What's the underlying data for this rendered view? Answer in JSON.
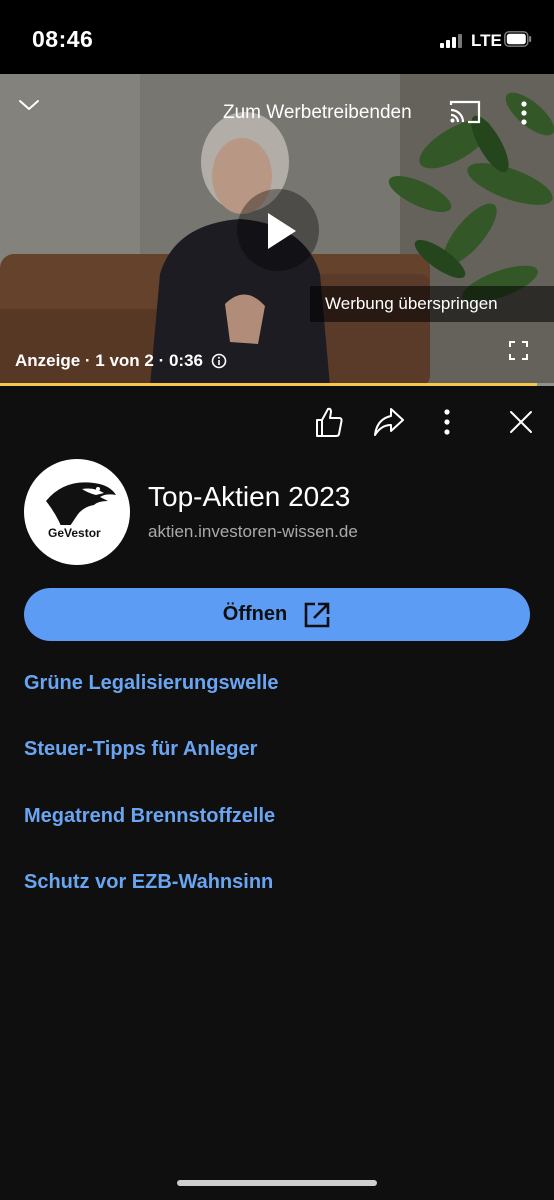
{
  "status_bar": {
    "time": "08:46",
    "network": "LTE"
  },
  "player": {
    "advertiser_link": "Zum Werbetreibenden",
    "skip_label": "Werbung überspringen",
    "ad_info": "Anzeige · 1 von 2 · 0:36",
    "progress_fraction": 0.97,
    "progress_color": "#f5c84c"
  },
  "ad": {
    "logo_text": "GeVestor",
    "title": "Top-Aktien 2023",
    "domain": "aktien.investoren-wissen.de",
    "open_button": "Öffnen",
    "links": [
      "Grüne Legalisierungswelle",
      "Steuer-Tipps für Anleger",
      "Megatrend Brennstoffzelle",
      "Schutz vor EZB-Wahnsinn"
    ]
  },
  "colors": {
    "background": "#0f0f0f",
    "accent": "#5c9cf5",
    "link": "#6aa5f2"
  },
  "icons": [
    "chevron-down-icon",
    "cast-icon",
    "more-vert-icon",
    "play-icon",
    "skip-next-icon",
    "info-icon",
    "fullscreen-icon",
    "thumbs-up-icon",
    "share-icon",
    "close-icon",
    "external-link-icon"
  ]
}
